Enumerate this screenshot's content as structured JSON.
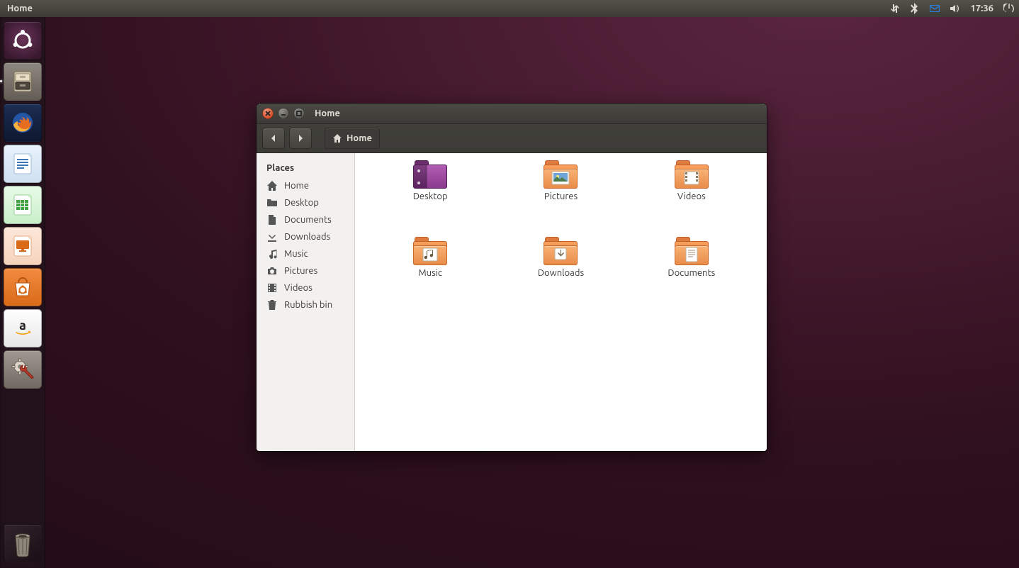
{
  "panel": {
    "title": "Home",
    "clock": "17:36"
  },
  "launcher": {
    "items": [
      {
        "name": "dash",
        "tip": "Dash"
      },
      {
        "name": "files",
        "tip": "Files",
        "running": true,
        "active": true
      },
      {
        "name": "firefox",
        "tip": "Firefox"
      },
      {
        "name": "writer",
        "tip": "LibreOffice Writer"
      },
      {
        "name": "calc",
        "tip": "LibreOffice Calc"
      },
      {
        "name": "impress",
        "tip": "LibreOffice Impress"
      },
      {
        "name": "software",
        "tip": "Ubuntu Software Center"
      },
      {
        "name": "amazon",
        "tip": "Amazon"
      },
      {
        "name": "settings",
        "tip": "System Settings"
      }
    ],
    "trash": "Rubbish Bin"
  },
  "window": {
    "title": "Home",
    "path": {
      "label": "Home"
    },
    "sidebar": {
      "header": "Places",
      "items": [
        {
          "icon": "home",
          "label": "Home"
        },
        {
          "icon": "desktop",
          "label": "Desktop"
        },
        {
          "icon": "documents",
          "label": "Documents"
        },
        {
          "icon": "downloads",
          "label": "Downloads"
        },
        {
          "icon": "music",
          "label": "Music"
        },
        {
          "icon": "pictures",
          "label": "Pictures"
        },
        {
          "icon": "videos",
          "label": "Videos"
        },
        {
          "icon": "trash",
          "label": "Rubbish bin"
        }
      ]
    },
    "files": [
      {
        "kind": "desktop",
        "label": "Desktop"
      },
      {
        "kind": "pictures",
        "label": "Pictures"
      },
      {
        "kind": "videos",
        "label": "Videos"
      },
      {
        "kind": "music",
        "label": "Music"
      },
      {
        "kind": "downloads",
        "label": "Downloads"
      },
      {
        "kind": "documents",
        "label": "Documents"
      }
    ]
  }
}
